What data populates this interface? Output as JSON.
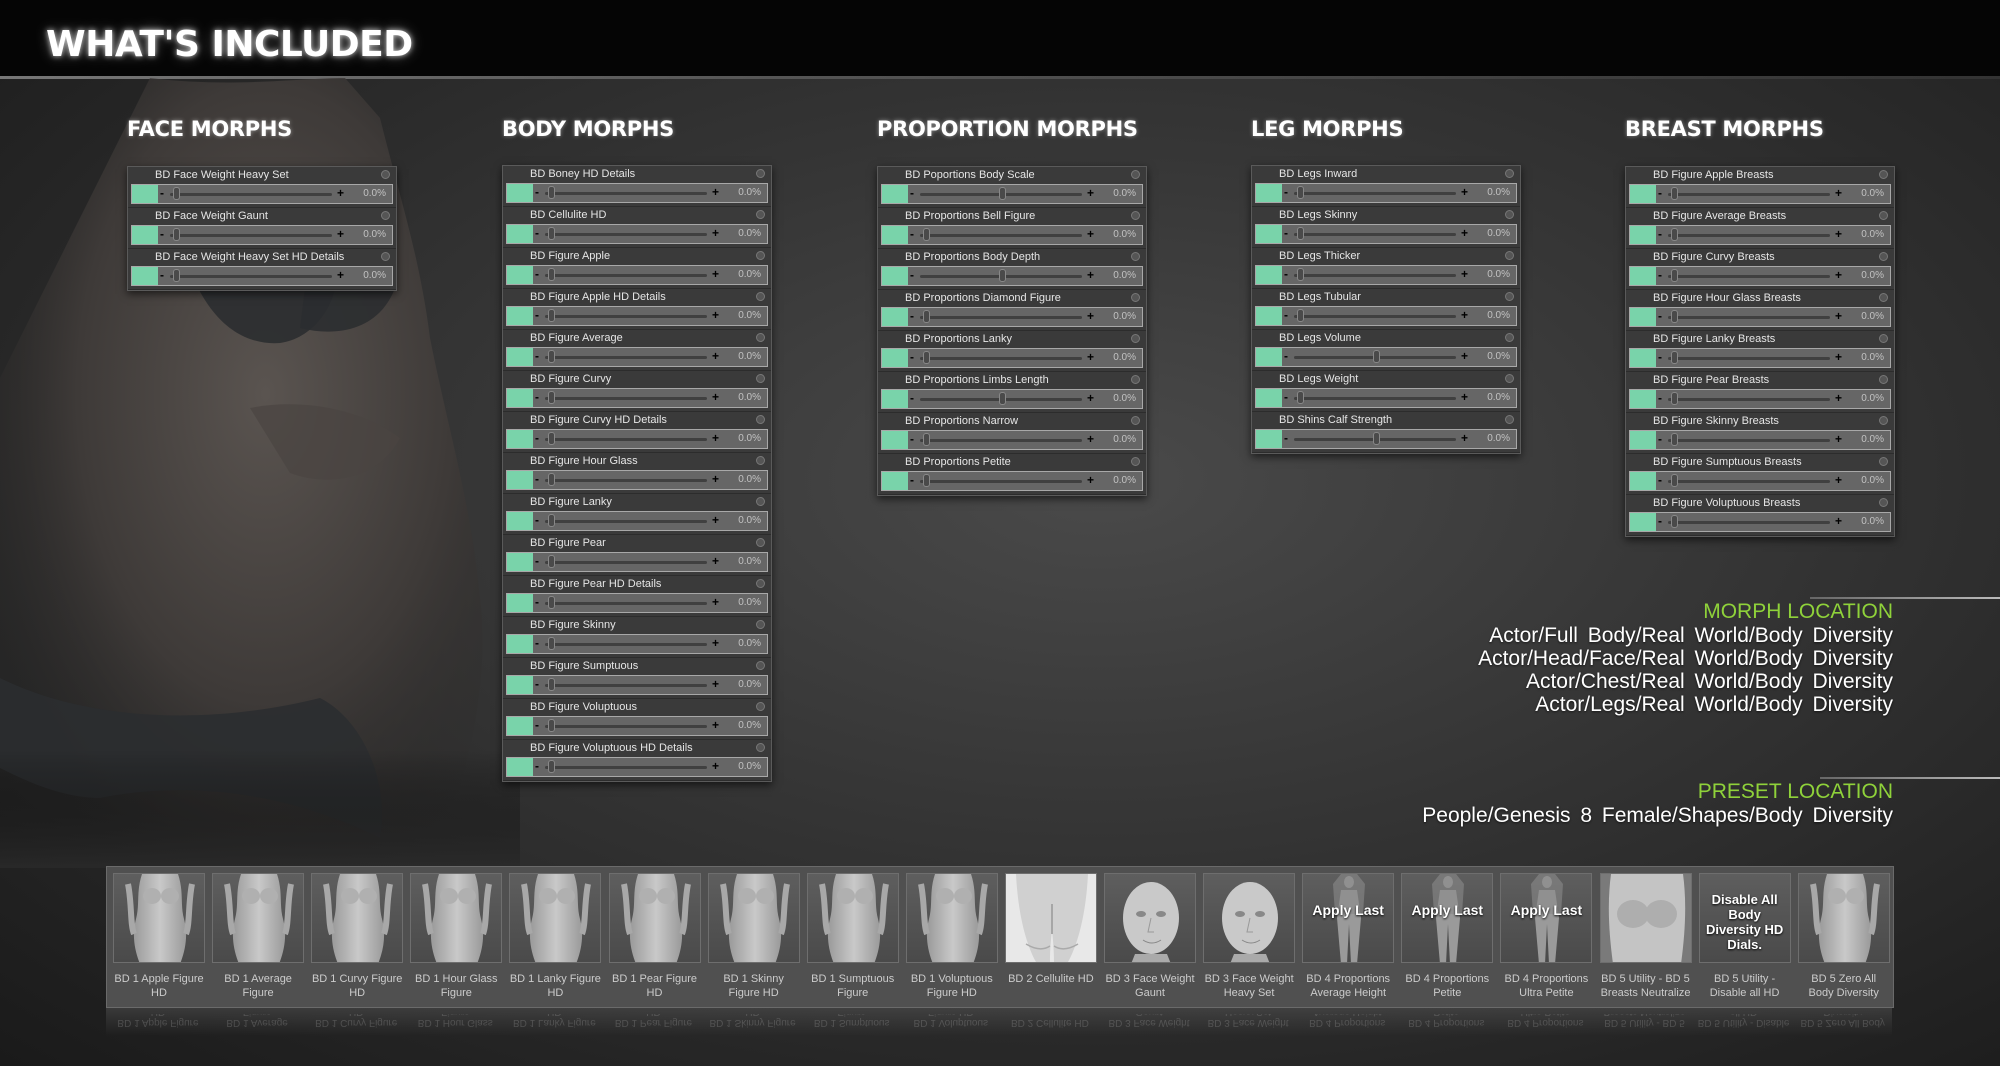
{
  "page_title": "WHAT'S INCLUDED",
  "columns": [
    {
      "title": "FACE MORPHS",
      "items": [
        {
          "label": "BD Face Weight Heavy Set",
          "value": "0.0%",
          "slider_pos": 0.02
        },
        {
          "label": "BD Face Weight Gaunt",
          "value": "0.0%",
          "slider_pos": 0.02
        },
        {
          "label": "BD Face Weight Heavy Set HD Details",
          "value": "0.0%",
          "slider_pos": 0.02
        }
      ]
    },
    {
      "title": "BODY MORPHS",
      "items": [
        {
          "label": "BD Boney HD Details",
          "value": "0.0%",
          "slider_pos": 0.02
        },
        {
          "label": "BD Cellulite HD",
          "value": "0.0%",
          "slider_pos": 0.02
        },
        {
          "label": "BD Figure Apple",
          "value": "0.0%",
          "slider_pos": 0.02
        },
        {
          "label": "BD Figure Apple HD Details",
          "value": "0.0%",
          "slider_pos": 0.02
        },
        {
          "label": "BD Figure Average",
          "value": "0.0%",
          "slider_pos": 0.02
        },
        {
          "label": "BD Figure Curvy",
          "value": "0.0%",
          "slider_pos": 0.02
        },
        {
          "label": "BD Figure Curvy HD Details",
          "value": "0.0%",
          "slider_pos": 0.02
        },
        {
          "label": "BD Figure Hour Glass",
          "value": "0.0%",
          "slider_pos": 0.02
        },
        {
          "label": "BD Figure Lanky",
          "value": "0.0%",
          "slider_pos": 0.02
        },
        {
          "label": "BD Figure Pear",
          "value": "0.0%",
          "slider_pos": 0.02
        },
        {
          "label": "BD Figure Pear HD Details",
          "value": "0.0%",
          "slider_pos": 0.02
        },
        {
          "label": "BD Figure Skinny",
          "value": "0.0%",
          "slider_pos": 0.02
        },
        {
          "label": "BD Figure Sumptuous",
          "value": "0.0%",
          "slider_pos": 0.02
        },
        {
          "label": "BD Figure Voluptuous",
          "value": "0.0%",
          "slider_pos": 0.02
        },
        {
          "label": "BD Figure Voluptuous HD Details",
          "value": "0.0%",
          "slider_pos": 0.02
        }
      ]
    },
    {
      "title": "PROPORTION MORPHS",
      "items": [
        {
          "label": "BD Poportions Body Scale",
          "value": "0.0%",
          "slider_pos": 0.5
        },
        {
          "label": "BD Proportions Bell Figure",
          "value": "0.0%",
          "slider_pos": 0.02
        },
        {
          "label": "BD Proportions Body Depth",
          "value": "0.0%",
          "slider_pos": 0.5
        },
        {
          "label": "BD Proportions Diamond Figure",
          "value": "0.0%",
          "slider_pos": 0.02
        },
        {
          "label": "BD Proportions Lanky",
          "value": "0.0%",
          "slider_pos": 0.02
        },
        {
          "label": "BD Proportions Limbs Length",
          "value": "0.0%",
          "slider_pos": 0.5
        },
        {
          "label": "BD Proportions Narrow",
          "value": "0.0%",
          "slider_pos": 0.02
        },
        {
          "label": "BD Proportions Petite",
          "value": "0.0%",
          "slider_pos": 0.02
        }
      ]
    },
    {
      "title": "LEG MORPHS",
      "items": [
        {
          "label": "BD Legs Inward",
          "value": "0.0%",
          "slider_pos": 0.02
        },
        {
          "label": "BD Legs Skinny",
          "value": "0.0%",
          "slider_pos": 0.02
        },
        {
          "label": "BD Legs Thicker",
          "value": "0.0%",
          "slider_pos": 0.02
        },
        {
          "label": "BD Legs Tubular",
          "value": "0.0%",
          "slider_pos": 0.02
        },
        {
          "label": "BD Legs Volume",
          "value": "0.0%",
          "slider_pos": 0.5
        },
        {
          "label": "BD Legs Weight",
          "value": "0.0%",
          "slider_pos": 0.02
        },
        {
          "label": "BD Shins Calf Strength",
          "value": "0.0%",
          "slider_pos": 0.5
        }
      ]
    },
    {
      "title": "BREAST MORPHS",
      "items": [
        {
          "label": "BD Figure Apple Breasts",
          "value": "0.0%",
          "slider_pos": 0.02
        },
        {
          "label": "BD Figure Average Breasts",
          "value": "0.0%",
          "slider_pos": 0.02
        },
        {
          "label": "BD Figure Curvy Breasts",
          "value": "0.0%",
          "slider_pos": 0.02
        },
        {
          "label": "BD Figure Hour Glass Breasts",
          "value": "0.0%",
          "slider_pos": 0.02
        },
        {
          "label": "BD Figure Lanky Breasts",
          "value": "0.0%",
          "slider_pos": 0.02
        },
        {
          "label": "BD Figure Pear Breasts",
          "value": "0.0%",
          "slider_pos": 0.02
        },
        {
          "label": "BD Figure Skinny Breasts",
          "value": "0.0%",
          "slider_pos": 0.02
        },
        {
          "label": "BD Figure Sumptuous Breasts",
          "value": "0.0%",
          "slider_pos": 0.02
        },
        {
          "label": "BD Figure Voluptuous Breasts",
          "value": "0.0%",
          "slider_pos": 0.02
        }
      ]
    }
  ],
  "morph_location": {
    "title": "MORPH LOCATION",
    "paths": [
      "Actor/Full Body/Real World/Body Diversity",
      "Actor/Head/Face/Real World/Body Diversity",
      "Actor/Chest/Real World/Body Diversity",
      "Actor/Legs/Real World/Body Diversity"
    ]
  },
  "preset_location": {
    "title": "PRESET LOCATION",
    "path": "People/Genesis 8 Female/Shapes/Body Diversity"
  },
  "presets": [
    {
      "caption": "BD 1 Apple Figure HD",
      "thumb": "body-figure-icon",
      "overlay": ""
    },
    {
      "caption": "BD 1 Average Figure",
      "thumb": "body-figure-icon",
      "overlay": ""
    },
    {
      "caption": "BD 1 Curvy Figure HD",
      "thumb": "body-figure-icon",
      "overlay": ""
    },
    {
      "caption": "BD 1 Hour Glass Figure",
      "thumb": "body-figure-icon",
      "overlay": ""
    },
    {
      "caption": "BD 1 Lanky Figure HD",
      "thumb": "body-figure-icon",
      "overlay": ""
    },
    {
      "caption": "BD 1 Pear Figure HD",
      "thumb": "body-figure-icon",
      "overlay": ""
    },
    {
      "caption": "BD 1 Skinny Figure HD",
      "thumb": "body-figure-icon",
      "overlay": ""
    },
    {
      "caption": "BD 1 Sumptuous Figure",
      "thumb": "body-figure-icon",
      "overlay": ""
    },
    {
      "caption": "BD 1 Voluptuous Figure HD",
      "thumb": "body-figure-icon",
      "overlay": ""
    },
    {
      "caption": "BD 2 Cellulite HD",
      "thumb": "hips-icon",
      "overlay": ""
    },
    {
      "caption": "BD 3 Face Weight Gaunt",
      "thumb": "head-icon",
      "overlay": ""
    },
    {
      "caption": "BD 3 Face Weight Heavy Set",
      "thumb": "head-icon",
      "overlay": ""
    },
    {
      "caption": "BD 4 Proportions Average Height",
      "thumb": "full-body-icon",
      "overlay": "Apply Last"
    },
    {
      "caption": "BD 4 Proportions Petite",
      "thumb": "full-body-icon",
      "overlay": "Apply Last"
    },
    {
      "caption": "BD 4 Proportions Ultra Petite",
      "thumb": "full-body-icon",
      "overlay": "Apply Last"
    },
    {
      "caption": "BD 5 Utility - BD 5 Breasts Neutralize",
      "thumb": "torso-icon",
      "overlay": ""
    },
    {
      "caption": "BD 5 Utility - Disable all HD",
      "thumb": "blank",
      "overlay": "Disable All Body Diversity HD Dials."
    },
    {
      "caption": "BD 5 Zero All Body Diversity",
      "thumb": "body-figure-icon",
      "overlay": ""
    }
  ],
  "colors": {
    "slider_fill": "#79d3aa",
    "location_title": "#8fd23a"
  }
}
